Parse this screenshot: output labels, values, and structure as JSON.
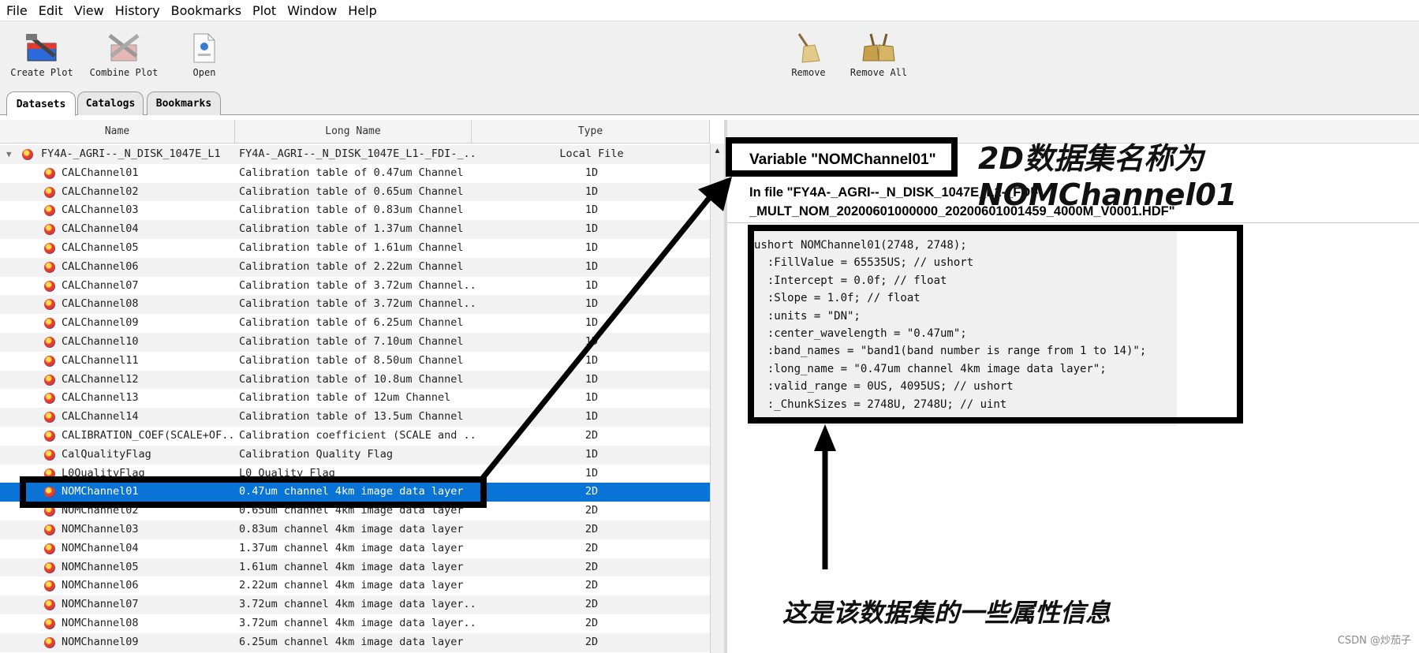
{
  "menu": [
    "File",
    "Edit",
    "View",
    "History",
    "Bookmarks",
    "Plot",
    "Window",
    "Help"
  ],
  "toolbar": {
    "create_plot": "Create Plot",
    "combine_plot": "Combine Plot",
    "open": "Open",
    "remove": "Remove",
    "remove_all": "Remove All"
  },
  "tabs": [
    "Datasets",
    "Catalogs",
    "Bookmarks"
  ],
  "columns": {
    "name": "Name",
    "long_name": "Long Name",
    "type": "Type"
  },
  "file_row": {
    "name": "FY4A-_AGRI--_N_DISK_1047E_L1-..",
    "long_name": "FY4A-_AGRI--_N_DISK_1047E_L1-_FDI-_..",
    "type": "Local File"
  },
  "rows": [
    {
      "name": "CALChannel01",
      "long_name": "Calibration table of 0.47um Channel",
      "type": "1D"
    },
    {
      "name": "CALChannel02",
      "long_name": "Calibration table of 0.65um Channel",
      "type": "1D"
    },
    {
      "name": "CALChannel03",
      "long_name": "Calibration table of 0.83um Channel",
      "type": "1D"
    },
    {
      "name": "CALChannel04",
      "long_name": "Calibration table of 1.37um Channel",
      "type": "1D"
    },
    {
      "name": "CALChannel05",
      "long_name": "Calibration table of 1.61um Channel",
      "type": "1D"
    },
    {
      "name": "CALChannel06",
      "long_name": "Calibration table of 2.22um Channel",
      "type": "1D"
    },
    {
      "name": "CALChannel07",
      "long_name": "Calibration table of 3.72um Channel..",
      "type": "1D"
    },
    {
      "name": "CALChannel08",
      "long_name": "Calibration table of 3.72um Channel..",
      "type": "1D"
    },
    {
      "name": "CALChannel09",
      "long_name": "Calibration table of 6.25um Channel",
      "type": "1D"
    },
    {
      "name": "CALChannel10",
      "long_name": "Calibration table of 7.10um Channel",
      "type": "1D"
    },
    {
      "name": "CALChannel11",
      "long_name": "Calibration table of 8.50um Channel",
      "type": "1D"
    },
    {
      "name": "CALChannel12",
      "long_name": "Calibration table of 10.8um Channel",
      "type": "1D"
    },
    {
      "name": "CALChannel13",
      "long_name": "Calibration table of 12um Channel",
      "type": "1D"
    },
    {
      "name": "CALChannel14",
      "long_name": "Calibration table of 13.5um Channel",
      "type": "1D"
    },
    {
      "name": "CALIBRATION_COEF(SCALE+OF..",
      "long_name": "Calibration coefficient (SCALE and ..",
      "type": "2D"
    },
    {
      "name": "CalQualityFlag",
      "long_name": "Calibration Quality Flag",
      "type": "1D"
    },
    {
      "name": "L0QualityFlag",
      "long_name": "L0 Quality Flag",
      "type": "1D"
    },
    {
      "name": "NOMChannel01",
      "long_name": "0.47um channel 4km image data layer",
      "type": "2D",
      "selected": true
    },
    {
      "name": "NOMChannel02",
      "long_name": "0.65um channel 4km image data layer",
      "type": "2D"
    },
    {
      "name": "NOMChannel03",
      "long_name": "0.83um channel 4km image data layer",
      "type": "2D"
    },
    {
      "name": "NOMChannel04",
      "long_name": "1.37um channel 4km image data layer",
      "type": "2D"
    },
    {
      "name": "NOMChannel05",
      "long_name": "1.61um channel 4km image data layer",
      "type": "2D"
    },
    {
      "name": "NOMChannel06",
      "long_name": "2.22um channel 4km image data layer",
      "type": "2D"
    },
    {
      "name": "NOMChannel07",
      "long_name": "3.72um channel 4km image data layer..",
      "type": "2D"
    },
    {
      "name": "NOMChannel08",
      "long_name": "3.72um channel 4km image data layer..",
      "type": "2D"
    },
    {
      "name": "NOMChannel09",
      "long_name": "6.25um channel 4km image data layer",
      "type": "2D"
    }
  ],
  "detail": {
    "variable_title": "Variable \"NOMChannel01\"",
    "file_line": "In file \"FY4A-_AGRI--_N_DISK_1047E_L1-_FDI-_MULT_NOM_20200601000000_20200601001459_4000M_V0001.HDF\"",
    "attributes": [
      "ushort NOMChannel01(2748, 2748);",
      "  :FillValue = 65535US; // ushort",
      "  :Intercept = 0.0f; // float",
      "  :Slope = 1.0f; // float",
      "  :units = \"DN\";",
      "  :center_wavelength = \"0.47um\";",
      "  :band_names = \"band1(band number is range from 1 to 14)\";",
      "  :long_name = \"0.47um channel 4km image data layer\";",
      "  :valid_range = 0US, 4095US; // ushort",
      "  :_ChunkSizes = 2748U, 2748U; // uint"
    ]
  },
  "annotations": {
    "top_note": "2D数据集名称为NOMChannel01",
    "bottom_note": "这是该数据集的一些属性信息"
  },
  "watermark": "CSDN @炒茄子",
  "colors": {
    "selection": "#0a74d6",
    "annotation": "#000000"
  }
}
